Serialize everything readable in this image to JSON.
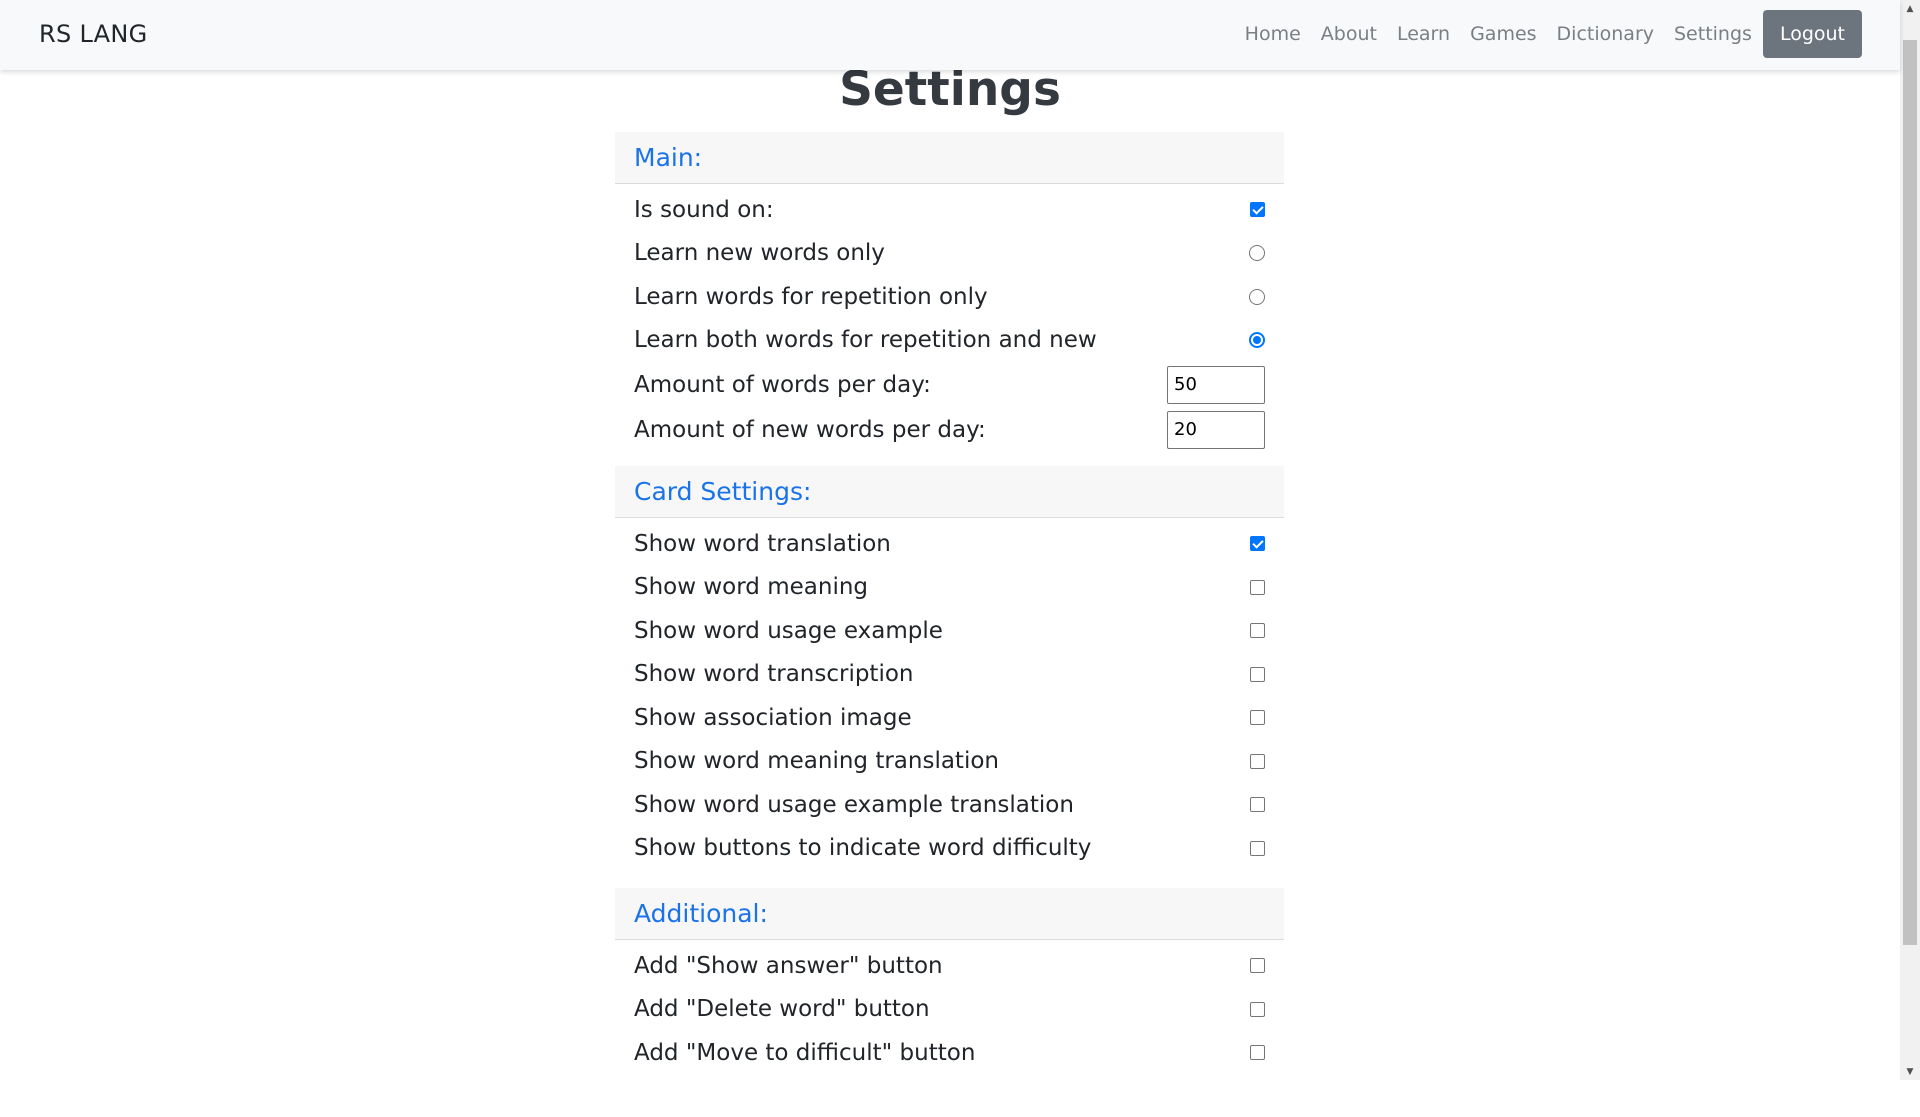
{
  "navbar": {
    "brand": "RS LANG",
    "links": [
      "Home",
      "About",
      "Learn",
      "Games",
      "Dictionary",
      "Settings"
    ],
    "logout_label": "Logout"
  },
  "page": {
    "title": "Settings"
  },
  "sections": {
    "main": {
      "title": "Main:",
      "sound_label": "Is sound on:",
      "sound_checked": true,
      "mode_new_label": "Learn new words only",
      "mode_repeat_label": "Learn words for repetition only",
      "mode_both_label": "Learn both words for repetition and new",
      "selected_mode": "both",
      "words_per_day_label": "Amount of words per day:",
      "words_per_day_value": "50",
      "new_words_per_day_label": "Amount of new words per day:",
      "new_words_per_day_value": "20"
    },
    "card": {
      "title": "Card Settings:",
      "items": [
        {
          "label": "Show word translation",
          "checked": true
        },
        {
          "label": "Show word meaning",
          "checked": false
        },
        {
          "label": "Show word usage example",
          "checked": false
        },
        {
          "label": "Show word transcription",
          "checked": false
        },
        {
          "label": "Show association image",
          "checked": false
        },
        {
          "label": "Show word meaning translation",
          "checked": false
        },
        {
          "label": "Show word usage example translation",
          "checked": false
        },
        {
          "label": "Show buttons to indicate word difficulty",
          "checked": false
        }
      ]
    },
    "additional": {
      "title": "Additional:",
      "items": [
        {
          "label": "Add \"Show answer\" button",
          "checked": false
        },
        {
          "label": "Add \"Delete word\" button",
          "checked": false
        },
        {
          "label": "Add \"Move to difficult\" button",
          "checked": false
        }
      ]
    }
  },
  "colors": {
    "accent": "#0075ff",
    "section_title": "#1a73e8",
    "navbar_bg": "#f8f9fa",
    "logout_bg": "#6c757d"
  },
  "icons": {
    "scroll_up": "▲",
    "scroll_down": "▼"
  }
}
